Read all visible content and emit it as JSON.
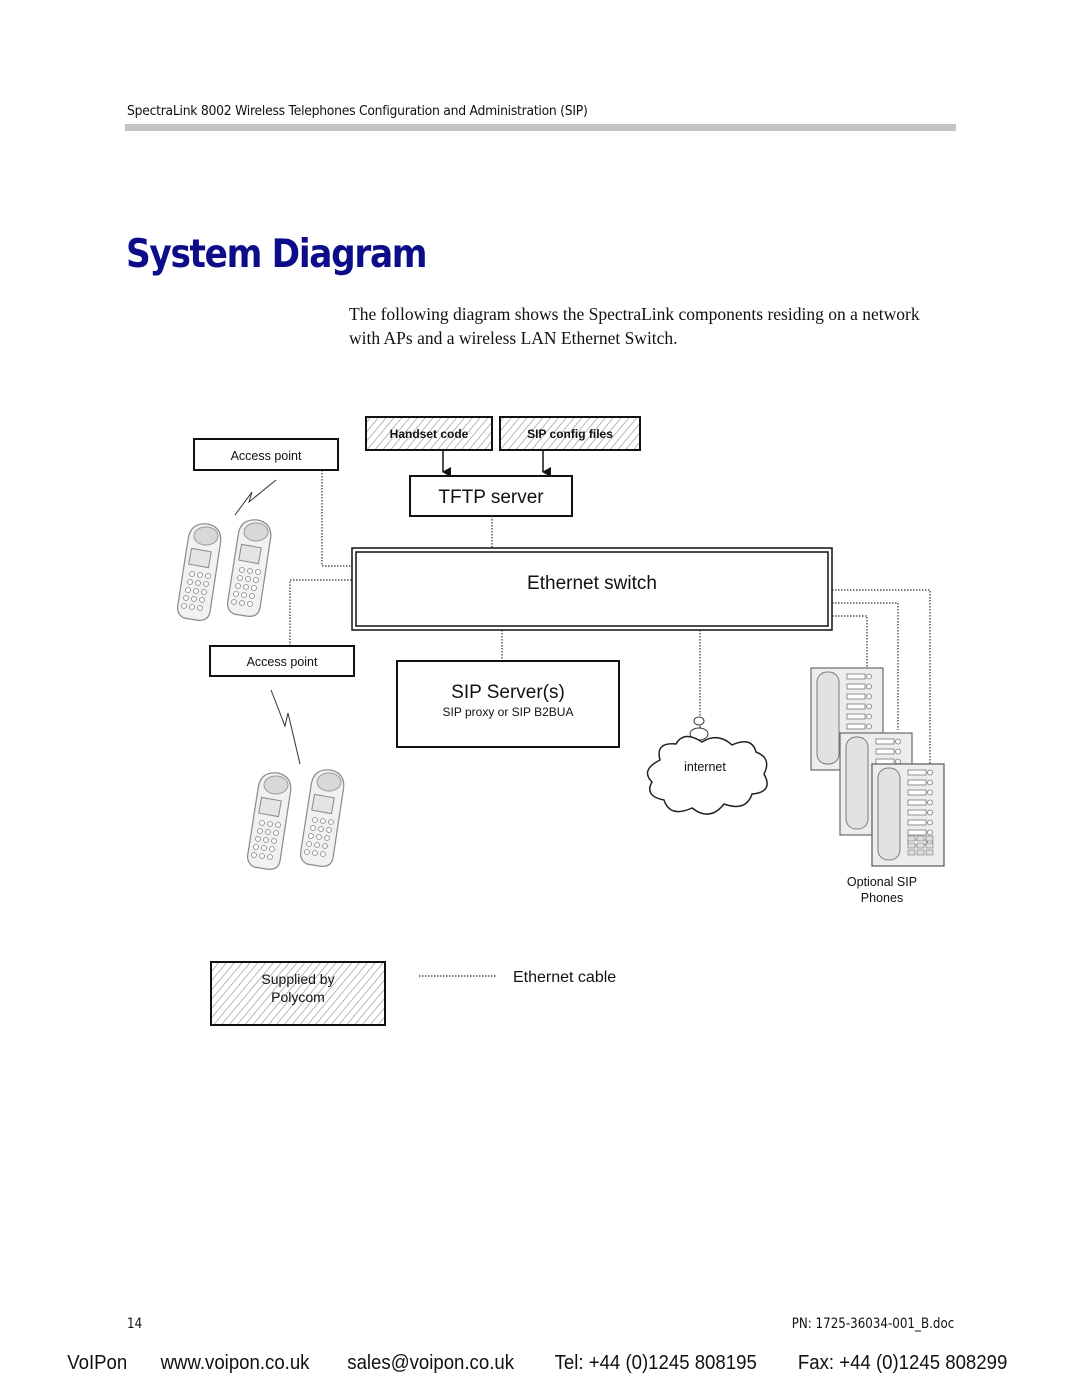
{
  "header": {
    "running_title": "SpectraLink 8002 Wireless Telephones Configuration and Administration (SIP)"
  },
  "page": {
    "title": "System Diagram",
    "intro": "The following diagram shows the SpectraLink components residing on a network with APs and a wireless LAN Ethernet Switch."
  },
  "diagram": {
    "handset_code": "Handset code",
    "sip_config_files": "SIP config files",
    "tftp_server": "TFTP server",
    "ethernet_switch": "Ethernet switch",
    "access_point_top": "Access point",
    "access_point_bottom": "Access point",
    "sip_servers": "SIP Server(s)",
    "sip_servers_sub": "SIP proxy or SIP B2BUA",
    "internet": "internet",
    "optional_sip_line1": "Optional SIP",
    "optional_sip_line2": "Phones",
    "legend": {
      "supplied_line1": "Supplied by",
      "supplied_line2": "Polycom",
      "ethernet_cable": "Ethernet cable"
    }
  },
  "footer": {
    "page_number": "14",
    "part_number": "PN: 1725-36034-001_B.doc",
    "company": "VoIPon",
    "website": "www.voipon.co.uk",
    "email": "sales@voipon.co.uk",
    "tel": "Tel: +44 (0)1245 808195",
    "fax": "Fax: +44 (0)1245 808299"
  },
  "colors": {
    "title_blue": "#0d0d8a",
    "rule_gray": "#c4c4c4"
  }
}
